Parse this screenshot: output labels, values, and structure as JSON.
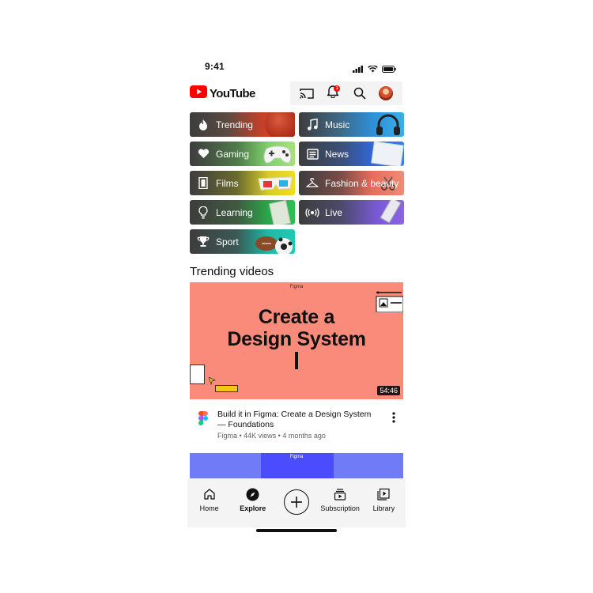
{
  "status_bar": {
    "time": "9:41"
  },
  "header": {
    "logo_text": "YouTube",
    "notification_count": "1",
    "icons": [
      "cast-icon",
      "bell-icon",
      "search-icon",
      "avatar"
    ]
  },
  "categories": [
    {
      "label": "Trending",
      "icon": "flame-icon"
    },
    {
      "label": "Music",
      "icon": "music-note-icon"
    },
    {
      "label": "Gaming",
      "icon": "heart-icon"
    },
    {
      "label": "News",
      "icon": "newspaper-icon"
    },
    {
      "label": "Films",
      "icon": "film-icon"
    },
    {
      "label": "Fashion & beauty",
      "icon": "hanger-icon"
    },
    {
      "label": "Learning",
      "icon": "lightbulb-icon"
    },
    {
      "label": "Live",
      "icon": "live-broadcast-icon"
    },
    {
      "label": "Sport",
      "icon": "trophy-icon"
    }
  ],
  "trending": {
    "section_title": "Trending videos",
    "videos": [
      {
        "thumb_brand": "Figma",
        "thumb_title_line1": "Create a",
        "thumb_title_line2": "Design System",
        "duration": "54:46",
        "title": "Build it in Figma: Create a Design System — Foundations",
        "meta": "Figma • 44K views • 4 months ago"
      },
      {
        "thumb_brand": "Figma"
      }
    ]
  },
  "bottom_nav": [
    {
      "label": "Home",
      "icon": "home-icon"
    },
    {
      "label": "Explore",
      "icon": "compass-icon"
    },
    {
      "label": "",
      "icon": "plus-circle-icon"
    },
    {
      "label": "Subscription",
      "icon": "subscriptions-icon"
    },
    {
      "label": "Library",
      "icon": "library-icon"
    }
  ],
  "colors": {
    "brand_red": "#ff0000",
    "thumb_coral": "#fa8a79",
    "text_primary": "#0f0f0f",
    "text_secondary": "#606060"
  }
}
